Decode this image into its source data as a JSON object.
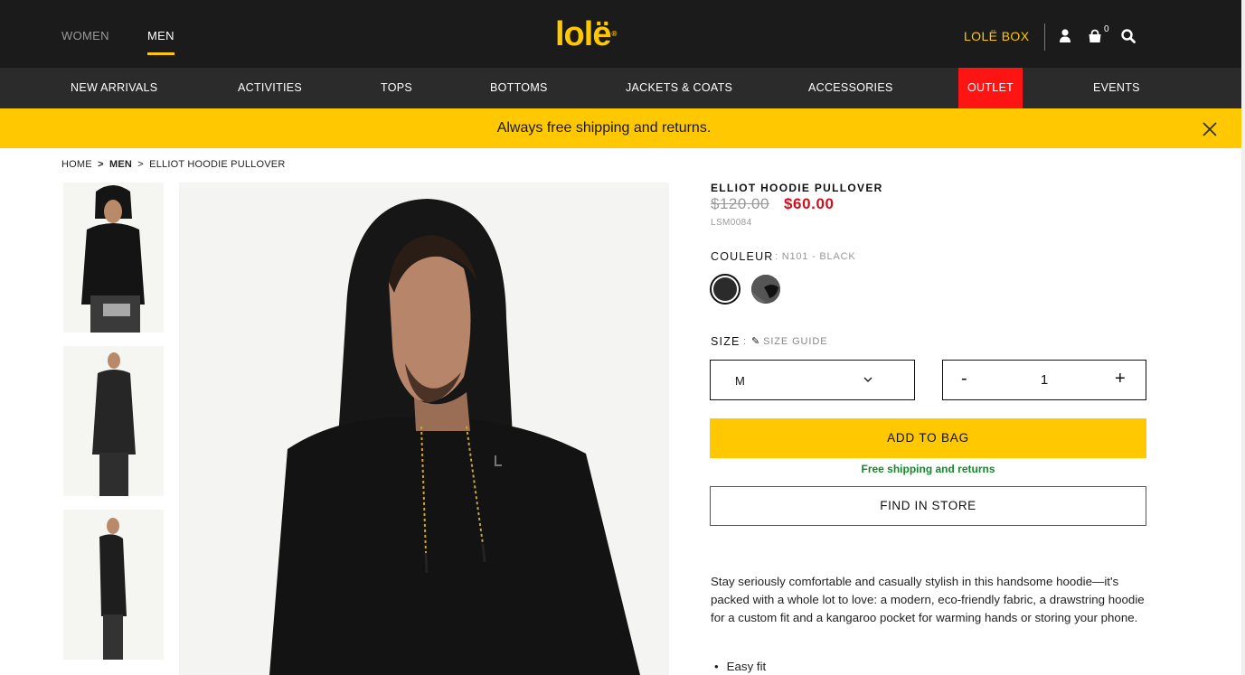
{
  "header": {
    "gender_tabs": [
      {
        "label": "WOMEN",
        "active": false
      },
      {
        "label": "MEN",
        "active": true
      }
    ],
    "logo": "lolë",
    "lole_box": "LOLË BOX",
    "cart_count": "0",
    "accent_color": "#ffc800"
  },
  "nav": {
    "items": [
      {
        "label": "NEW ARRIVALS"
      },
      {
        "label": "ACTIVITIES"
      },
      {
        "label": "TOPS"
      },
      {
        "label": "BOTTOMS"
      },
      {
        "label": "JACKETS & COATS"
      },
      {
        "label": "ACCESSORIES"
      },
      {
        "label": "OUTLET",
        "color": "#ff1414"
      },
      {
        "label": "EVENTS"
      }
    ]
  },
  "promo": {
    "text": "Always free shipping and returns."
  },
  "breadcrumb": {
    "home": "HOME",
    "sep": ">",
    "category": "MEN",
    "current": "ELLIOT HOODIE PULLOVER"
  },
  "product": {
    "title": "ELLIOT HOODIE PULLOVER",
    "old_price": "$120.00",
    "new_price": "$60.00",
    "sku": "LSM0084",
    "color_label": "COULEUR",
    "color_value": ": N101 - BLACK",
    "swatches": [
      {
        "name": "black",
        "color": "#2b2b2b",
        "selected": true
      },
      {
        "name": "grey-camo",
        "color": "#4b4b4b",
        "selected": false
      }
    ],
    "size_label": "SIZE",
    "size_sep": ":",
    "size_guide": "SIZE GUIDE",
    "size_value": "M",
    "qty_minus": "-",
    "qty_value": "1",
    "qty_plus": "+",
    "add_to_bag": "ADD TO BAG",
    "free_shipping": "Free shipping and returns",
    "find_in_store": "FIND IN STORE",
    "description": "Stay seriously comfortable and casually stylish in this handsome hoodie—it's packed with a whole lot to love: a modern, eco-friendly fabric, a drawstring hoodie for a custom fit and a kangaroo pocket for warming hands or storing your phone.",
    "features": [
      "Easy fit"
    ]
  }
}
